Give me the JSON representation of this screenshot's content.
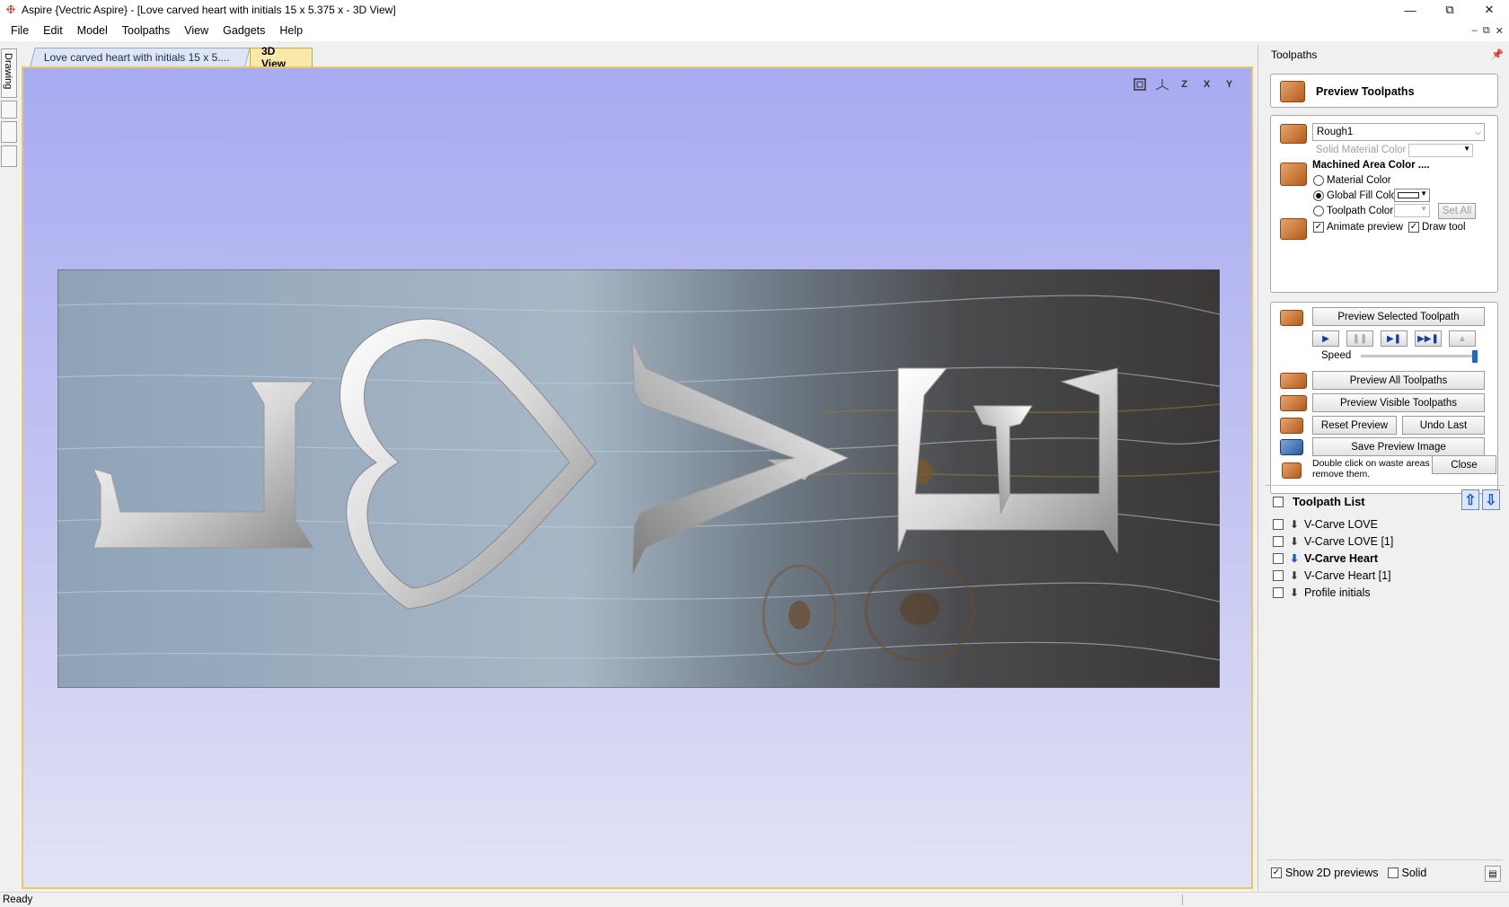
{
  "window": {
    "title": "Aspire {Vectric Aspire} - [Love carved heart with initials 15 x 5.375 x  - 3D View]",
    "app_icon": "aspire-logo-icon",
    "controls": [
      "minimize-icon",
      "restore-icon",
      "close-icon"
    ]
  },
  "menu": {
    "items": [
      "File",
      "Edit",
      "Model",
      "Toolpaths",
      "View",
      "Gadgets",
      "Help"
    ]
  },
  "left_strip": {
    "drawing_tab": "Drawing"
  },
  "doc_tabs": {
    "inactive": "Love carved heart with initials 15 x 5....",
    "active": "3D View"
  },
  "view_toolbar": {
    "buttons": [
      "zoom-extents-icon",
      "iso-view-icon",
      "view-z-icon",
      "view-x-icon",
      "view-y-icon"
    ],
    "labels": [
      "",
      "",
      "Z",
      "X",
      "Y"
    ]
  },
  "board_letters": {
    "left": "L",
    "middle": "V",
    "right": "E"
  },
  "status": {
    "text": "Ready"
  },
  "panel": {
    "title": "Toolpaths",
    "preview_title": "Preview Toolpaths",
    "material_select": "Rough1",
    "solid_material_color": "Solid Material Color",
    "machined_area_color": "Machined Area Color ....",
    "radio_options": [
      {
        "label": "Material Color",
        "selected": false
      },
      {
        "label": "Global Fill Color",
        "selected": true
      },
      {
        "label": "Toolpath Color",
        "selected": false
      }
    ],
    "set_all": "Set All",
    "animate_preview": {
      "label": "Animate preview",
      "checked": true
    },
    "draw_tool": {
      "label": "Draw tool",
      "checked": true
    },
    "preview_selected": "Preview Selected Toolpath",
    "playback": [
      "play-icon",
      "pause-icon",
      "step-icon",
      "fast-forward-icon",
      "skip-to-end-icon"
    ],
    "speed_label": "Speed",
    "speed_value": 1.0,
    "preview_all": "Preview All Toolpaths",
    "preview_visible": "Preview Visible Toolpaths",
    "reset_preview": "Reset Preview",
    "undo_last": "Undo Last",
    "save_preview_image": "Save Preview Image",
    "hint": "Double click on waste areas in 3D view to remove them.",
    "close": "Close"
  },
  "toolpath_list": {
    "title": "Toolpath List",
    "items": [
      {
        "name": "V-Carve LOVE",
        "checked": false,
        "bold": false
      },
      {
        "name": "V-Carve LOVE [1]",
        "checked": false,
        "bold": false
      },
      {
        "name": "V-Carve Heart",
        "checked": false,
        "bold": true
      },
      {
        "name": "V-Carve Heart [1]",
        "checked": false,
        "bold": false
      },
      {
        "name": "Profile initials",
        "checked": false,
        "bold": false
      }
    ],
    "show_2d_previews": {
      "label": "Show 2D previews",
      "checked": true
    },
    "solid": {
      "label": "Solid",
      "checked": false
    }
  },
  "colors": {
    "view_top": "#a9abf2",
    "view_bottom": "#e2e2f6",
    "accent_tab": "#f8e9a8",
    "slider": "#1a6ad0"
  }
}
